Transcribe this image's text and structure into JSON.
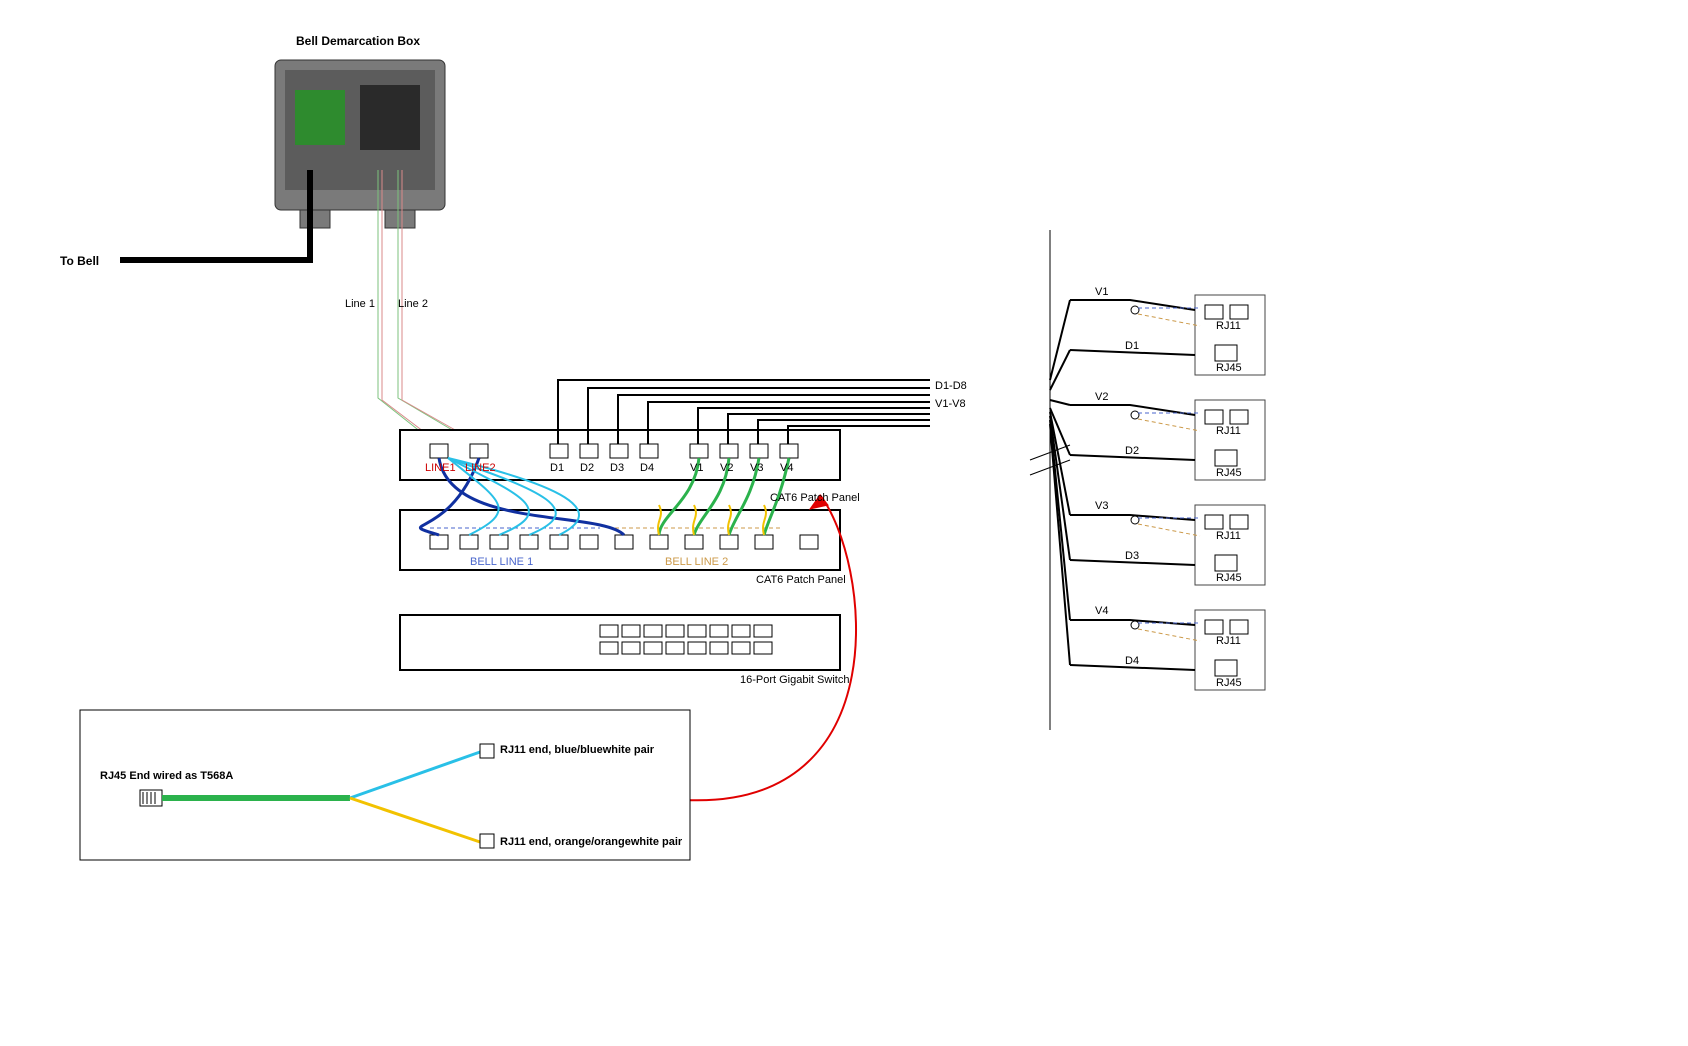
{
  "demarc": {
    "title": "Bell Demarcation Box",
    "to_bell": "To Bell",
    "line1": "Line 1",
    "line2": "Line 2"
  },
  "patch_panel_top": {
    "line1": "LINE1",
    "line2": "LINE2",
    "d1": "D1",
    "d2": "D2",
    "d3": "D3",
    "d4": "D4",
    "v1": "V1",
    "v2": "V2",
    "v3": "V3",
    "v4": "V4",
    "label": "CAT6 Patch Panel"
  },
  "patch_panel_bottom": {
    "bell1": "BELL LINE 1",
    "bell2": "BELL LINE 2",
    "label": "CAT6 Patch Panel"
  },
  "switch": {
    "label": "16-Port Gigabit Switch"
  },
  "bundle": {
    "d": "D1-D8",
    "v": "V1-V8"
  },
  "legend": {
    "rj45": "RJ45 End wired as T568A",
    "rj11_blue": "RJ11 end, blue/bluewhite pair",
    "rj11_orange": "RJ11 end, orange/orangewhite pair"
  },
  "rooms": [
    {
      "v": "V1",
      "d": "D1",
      "rj11": "RJ11",
      "rj45": "RJ45"
    },
    {
      "v": "V2",
      "d": "D2",
      "rj11": "RJ11",
      "rj45": "RJ45"
    },
    {
      "v": "V3",
      "d": "D3",
      "rj11": "RJ11",
      "rj45": "RJ45"
    },
    {
      "v": "V4",
      "d": "D4",
      "rj11": "RJ11",
      "rj45": "RJ45"
    }
  ],
  "chart_data": {
    "type": "network-wiring-diagram",
    "devices": [
      {
        "id": "demarc",
        "label": "Bell Demarcation Box",
        "outputs": [
          "Line 1",
          "Line 2"
        ],
        "upstream": "To Bell"
      },
      {
        "id": "patch_top",
        "label": "CAT6 Patch Panel",
        "ports": [
          "LINE1",
          "LINE2",
          "D1",
          "D2",
          "D3",
          "D4",
          "V1",
          "V2",
          "V3",
          "V4"
        ]
      },
      {
        "id": "patch_bottom",
        "label": "CAT6 Patch Panel",
        "groups": [
          {
            "label": "BELL LINE 1",
            "ports": 5
          },
          {
            "label": "BELL LINE 2",
            "ports": 5
          }
        ]
      },
      {
        "id": "switch",
        "label": "16-Port Gigabit Switch",
        "ports": 16
      }
    ],
    "cable_bundles": [
      {
        "label": "D1-D8",
        "count": 8,
        "from": "patch_top D ports",
        "to": "room RJ45 jacks"
      },
      {
        "label": "V1-V8",
        "count": 8,
        "from": "patch_top V ports",
        "to": "room RJ11 jacks"
      }
    ],
    "patch_cables": [
      {
        "from": "patch_top.LINE1",
        "to": "patch_bottom.BELL LINE 1 group",
        "via": "RJ45→RJ11 splitter",
        "pairs": [
          "blue/bluewhite (V1-V4 on LINE1)"
        ]
      },
      {
        "from": "patch_top.LINE2",
        "to": "patch_bottom.BELL LINE 2 group",
        "via": "RJ45→RJ11 splitter",
        "pairs": [
          "orange/orangewhite (V1-V4 on LINE2)"
        ]
      },
      {
        "from": "patch_top.V1-V4",
        "to": "patch_bottom jacks",
        "type": "green patch"
      }
    ],
    "room_wallplates": [
      {
        "group": "1",
        "v": "V1",
        "d": "D1",
        "jacks": [
          "RJ11",
          "RJ11",
          "RJ45"
        ]
      },
      {
        "group": "2",
        "v": "V2",
        "d": "D2",
        "jacks": [
          "RJ11",
          "RJ11",
          "RJ45"
        ]
      },
      {
        "group": "3",
        "v": "V3",
        "d": "D3",
        "jacks": [
          "RJ11",
          "RJ11",
          "RJ45"
        ]
      },
      {
        "group": "4",
        "v": "V4",
        "d": "D4",
        "jacks": [
          "RJ11",
          "RJ11",
          "RJ45"
        ]
      }
    ],
    "legend_cable": {
      "rj45_end": "RJ45 End wired as T568A",
      "split_blue": "RJ11 end, blue/bluewhite pair",
      "split_orange": "RJ11 end, orange/orangewhite pair"
    }
  }
}
